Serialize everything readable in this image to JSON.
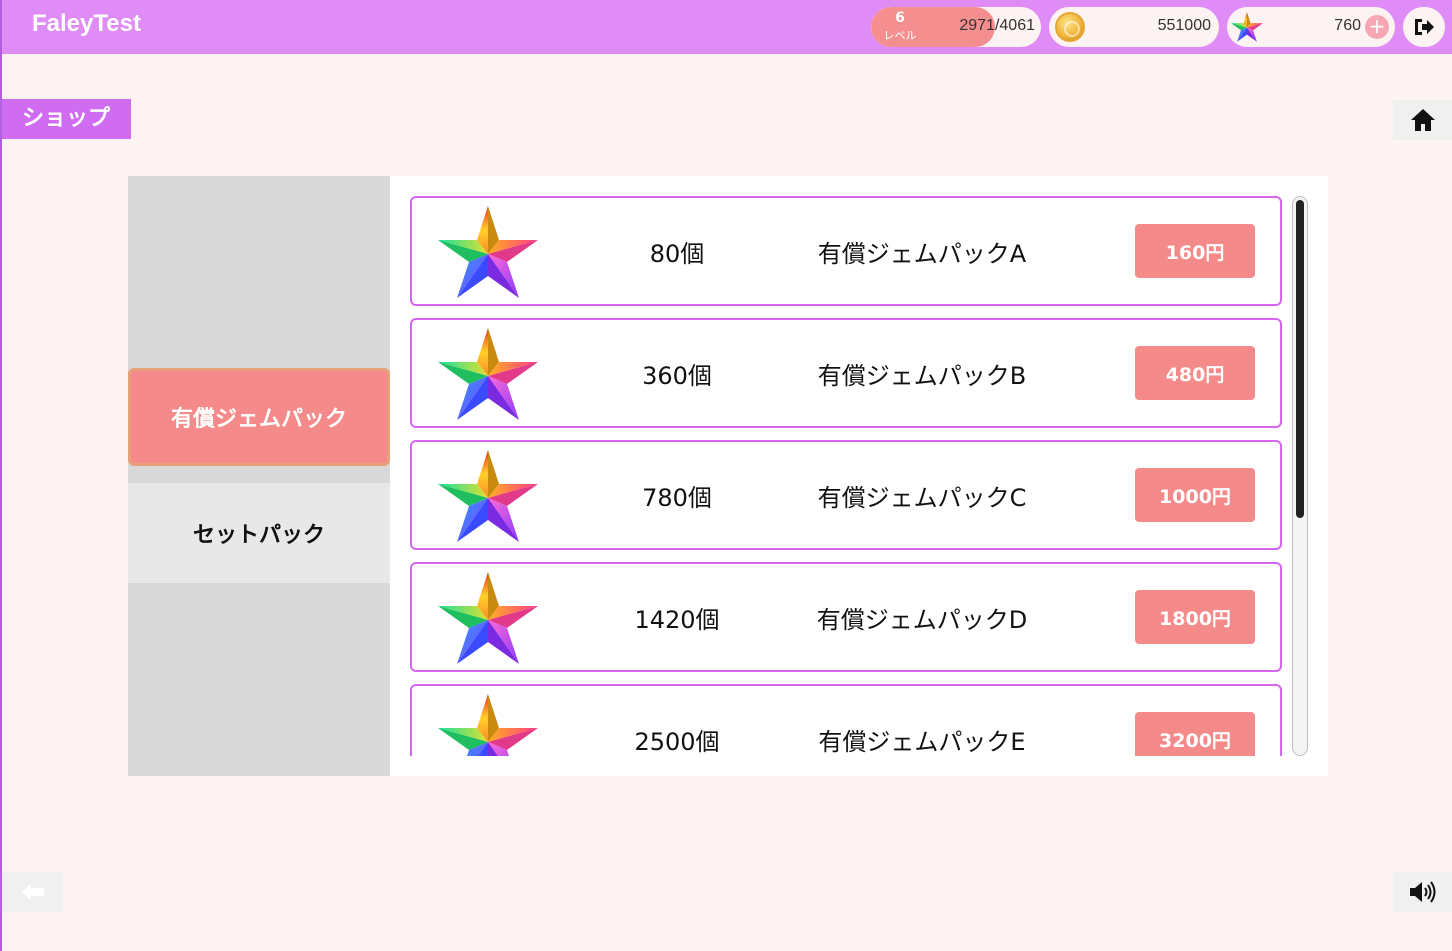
{
  "header": {
    "app_title": "FaleyTest",
    "level": {
      "number": "6",
      "label": "レベル",
      "exp": "2971/4061",
      "progress": 0.73
    },
    "coins": "551000",
    "gems": "760",
    "plus_label": "+"
  },
  "shop_tag": "ショップ",
  "categories": [
    {
      "label": "有償ジェムパック",
      "active": true
    },
    {
      "label": "セットパック",
      "active": false
    }
  ],
  "items": [
    {
      "qty": "80個",
      "name": "有償ジェムパックA",
      "price": "160円"
    },
    {
      "qty": "360個",
      "name": "有償ジェムパックB",
      "price": "480円"
    },
    {
      "qty": "780個",
      "name": "有償ジェムパックC",
      "price": "1000円"
    },
    {
      "qty": "1420個",
      "name": "有償ジェムパックD",
      "price": "1800円"
    },
    {
      "qty": "2500個",
      "name": "有償ジェムパックE",
      "price": "3200円"
    }
  ],
  "icons": {
    "coin": "coin-icon",
    "gem": "rainbow-star-icon",
    "logout": "logout-icon",
    "home": "home-icon",
    "back": "back-arrow-icon",
    "sound": "speaker-icon"
  },
  "colors": {
    "header_bg": "#e08cf6",
    "accent_pink": "#f58a8a",
    "item_border": "#d566f0",
    "page_bg": "#fdf3f2",
    "shop_tag": "#d06cf2"
  }
}
